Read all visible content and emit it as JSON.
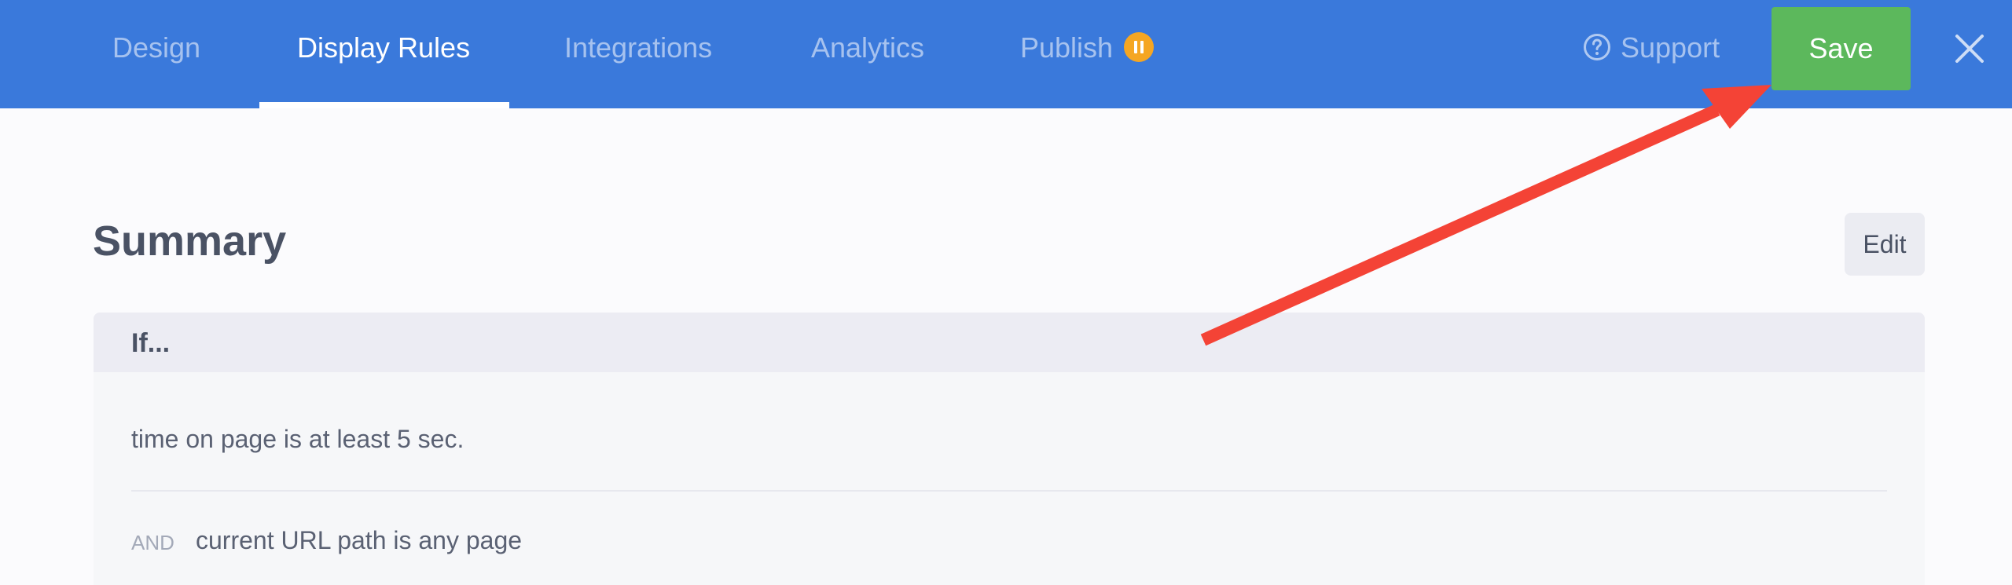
{
  "nav": {
    "tabs": [
      {
        "label": "Design"
      },
      {
        "label": "Display Rules"
      },
      {
        "label": "Integrations"
      },
      {
        "label": "Analytics"
      },
      {
        "label": "Publish"
      }
    ],
    "active_tab": "Display Rules",
    "publish_status_icon": "pause-icon",
    "support_label": "Support",
    "support_icon": "help-circle-icon",
    "save_label": "Save",
    "close_icon": "close-icon"
  },
  "summary": {
    "title": "Summary",
    "edit_label": "Edit",
    "section_header": "If...",
    "rules": [
      {
        "operator": "",
        "text": "time on page is at least 5 sec."
      },
      {
        "operator": "AND",
        "text": "current URL path is any page"
      }
    ]
  },
  "annotation": {
    "type": "arrow",
    "points_to": "save-button",
    "color": "#f44336"
  },
  "colors": {
    "header_bg": "#3a79db",
    "save_bg": "#5cb85c",
    "publish_badge": "#f5a623",
    "annotation_arrow": "#f44336"
  }
}
